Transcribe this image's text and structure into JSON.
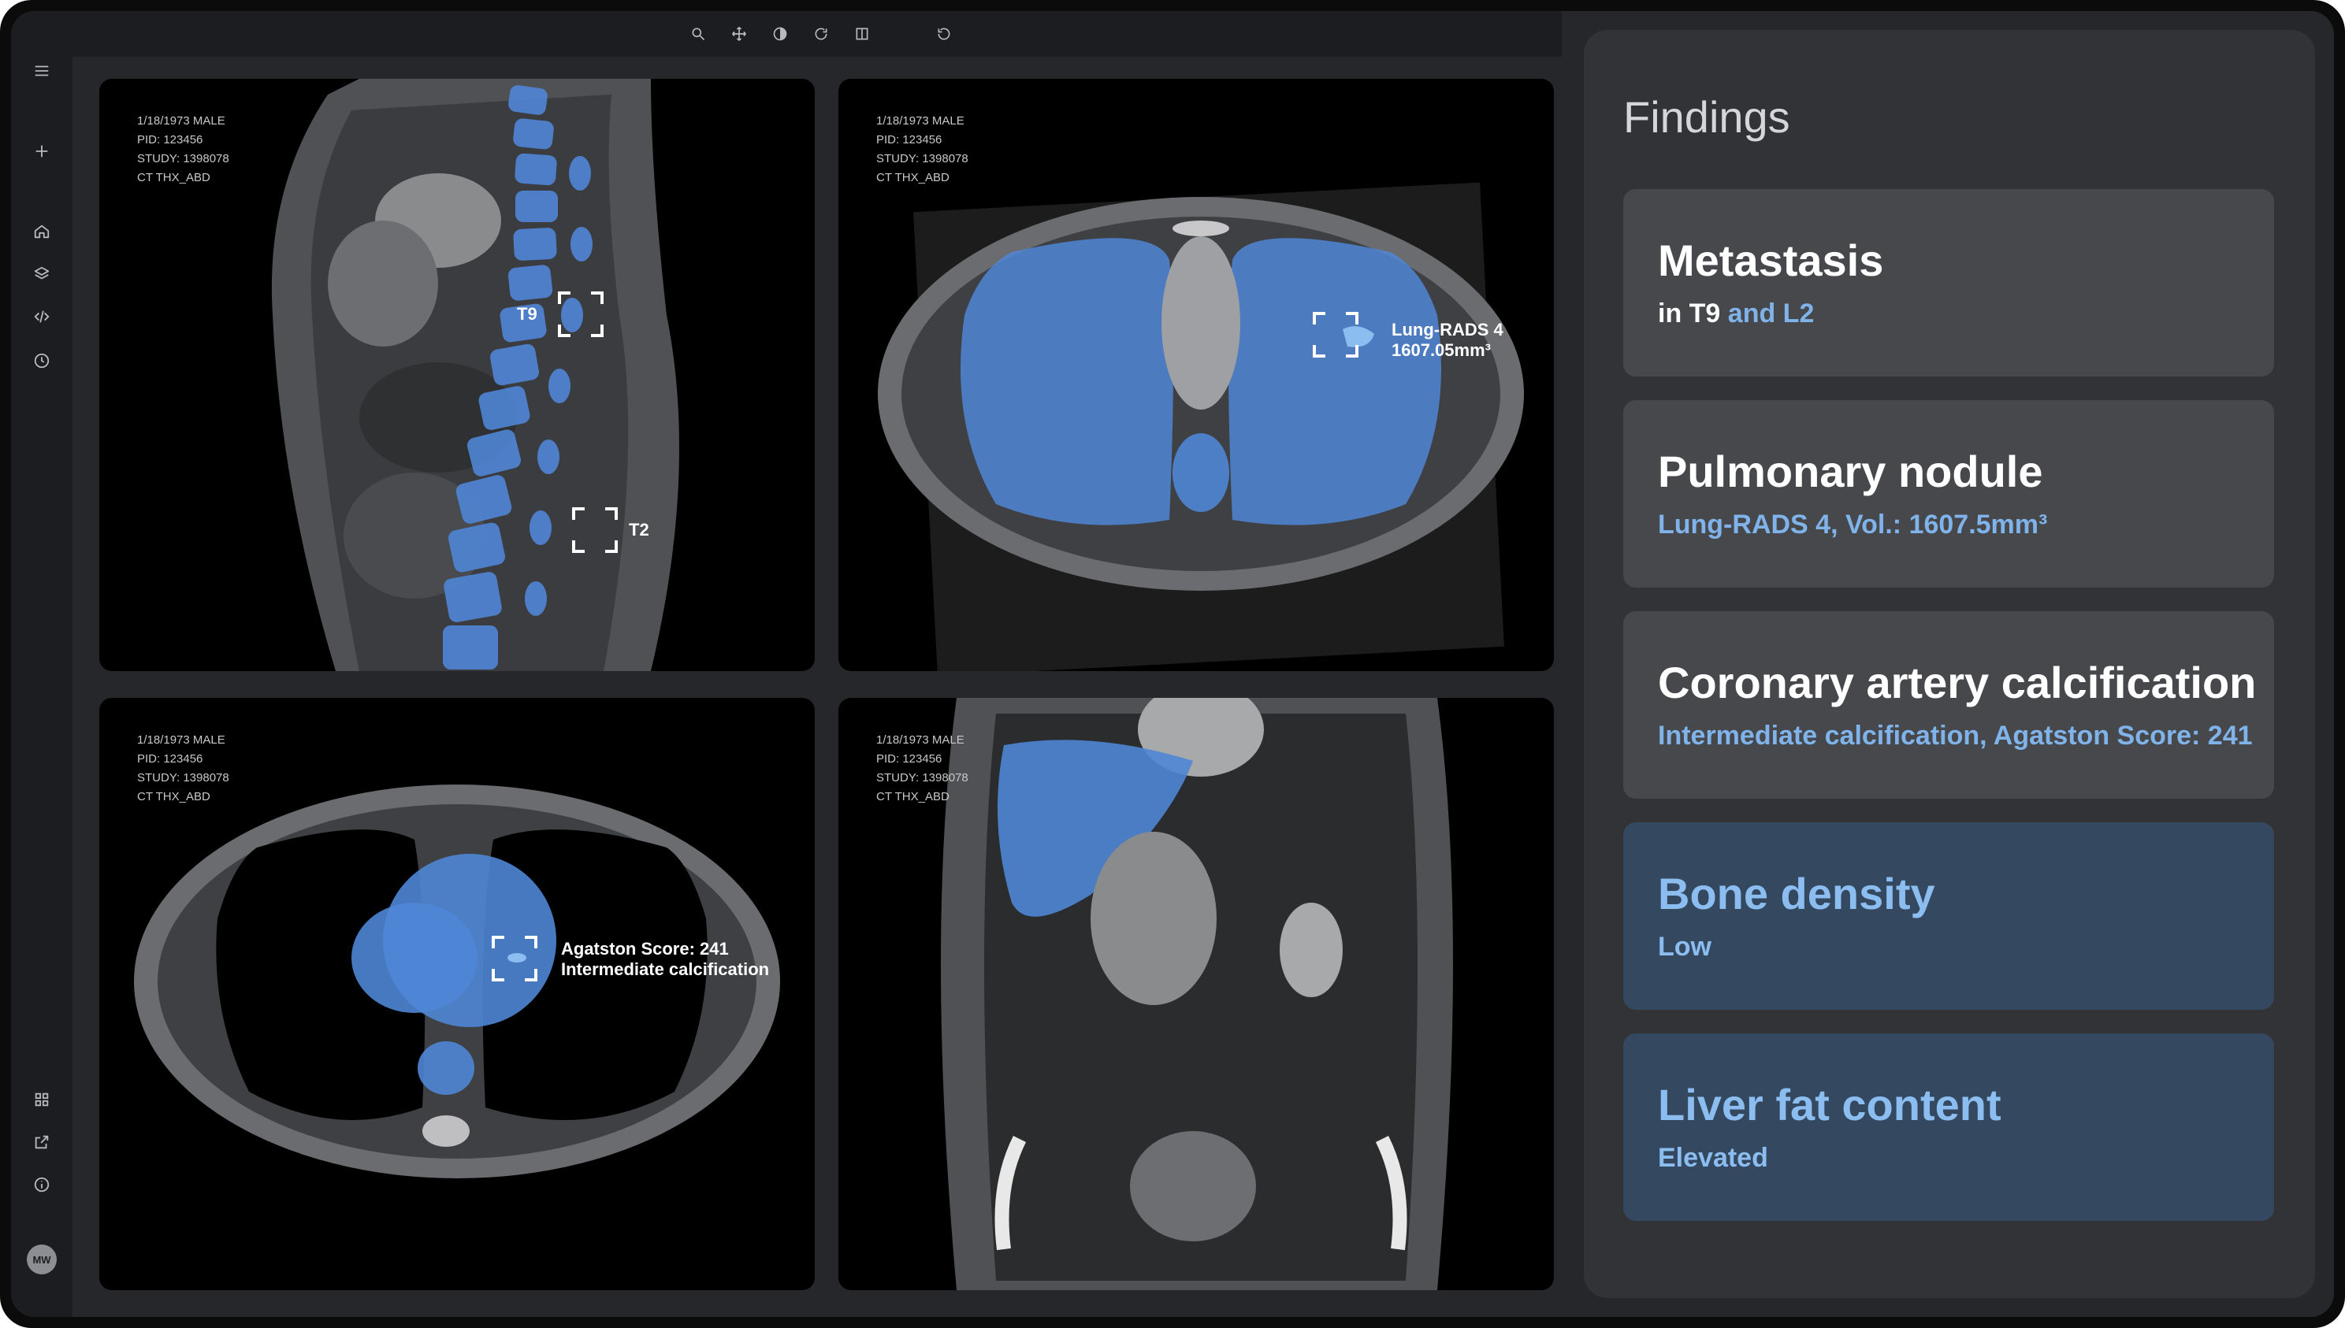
{
  "sidebar": {
    "icons": [
      "menu-icon",
      "plus-icon",
      "home-icon",
      "layers-icon",
      "code-icon",
      "clock-icon",
      "grid-icon",
      "external-link-icon",
      "info-icon"
    ],
    "avatar_initials": "MW"
  },
  "toolbar": {
    "icons": [
      "zoom-icon",
      "pan-icon",
      "contrast-icon",
      "rotate-icon",
      "split-view-icon",
      "undo-icon"
    ]
  },
  "patient_overlay": {
    "line1": "1/18/1973 MALE",
    "line2": "PID: 123456",
    "line3": "STUDY: 1398078",
    "line4": "CT THX_ABD"
  },
  "viewports": {
    "sagittal": {
      "label_t9": "T9",
      "label_t2": "T2"
    },
    "axial_lung": {
      "line1": "Lung-RADS 4",
      "line2": "1607.05mm³"
    },
    "axial_heart": {
      "line1": "Agatston Score: 241",
      "line2": "Intermediate calcification"
    }
  },
  "findings": {
    "title": "Findings",
    "cards": [
      {
        "title": "Metastasis",
        "sub_white": "in T9",
        "sub_blue": " and L2"
      },
      {
        "title": "Pulmonary nodule",
        "sub": "Lung-RADS 4, Vol.: 1607.5mm³"
      },
      {
        "title": "Coronary artery calcification",
        "sub": "Intermediate calcification, Agatston Score: 241"
      },
      {
        "title": "Bone density",
        "sub": "Low"
      },
      {
        "title": "Liver fat content",
        "sub": "Elevated"
      }
    ]
  },
  "colors": {
    "segmentation_blue": "#4f86d6",
    "accent_text_blue": "#7fb3ea",
    "highlight_card": "#34485f",
    "card": "#47484c",
    "panel": "#323337"
  }
}
